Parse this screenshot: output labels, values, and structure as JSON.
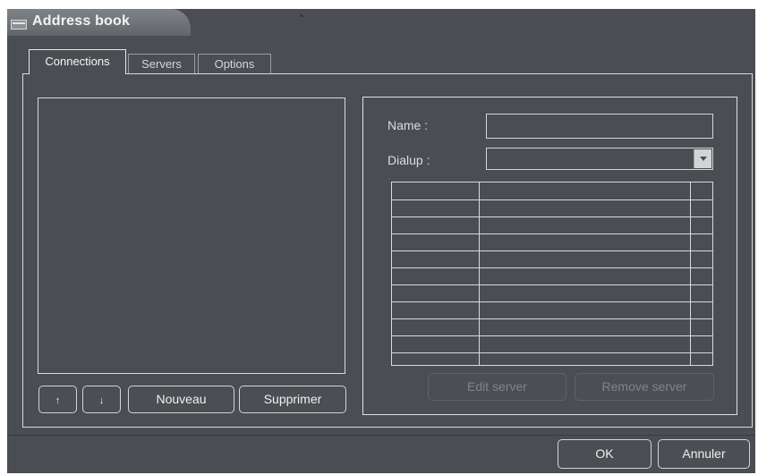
{
  "window": {
    "title": "Address book",
    "cursor_mark": "ᐢ"
  },
  "tabs": [
    {
      "label": "Connections",
      "active": true
    },
    {
      "label": "Servers",
      "active": false
    },
    {
      "label": "Options",
      "active": false
    }
  ],
  "connections": {
    "up_button_label": "↑",
    "down_button_label": "↓",
    "new_button_label": "Nouveau",
    "delete_button_label": "Supprimer"
  },
  "details": {
    "name_label": "Name :",
    "name_value": "",
    "dialup_label": "Dialup :",
    "dialup_value": "",
    "edit_server_label": "Edit server",
    "remove_server_label": "Remove server"
  },
  "footer": {
    "ok_label": "OK",
    "cancel_label": "Annuler"
  },
  "icons": {
    "title": "address-book-icon",
    "up": "arrow-up-icon",
    "down": "arrow-down-icon",
    "dropdown": "chevron-down-icon"
  },
  "colors": {
    "background": "#4a4d51",
    "border": "#d9dadc",
    "text": "#f0f0f0",
    "disabled_text": "#80848a"
  }
}
